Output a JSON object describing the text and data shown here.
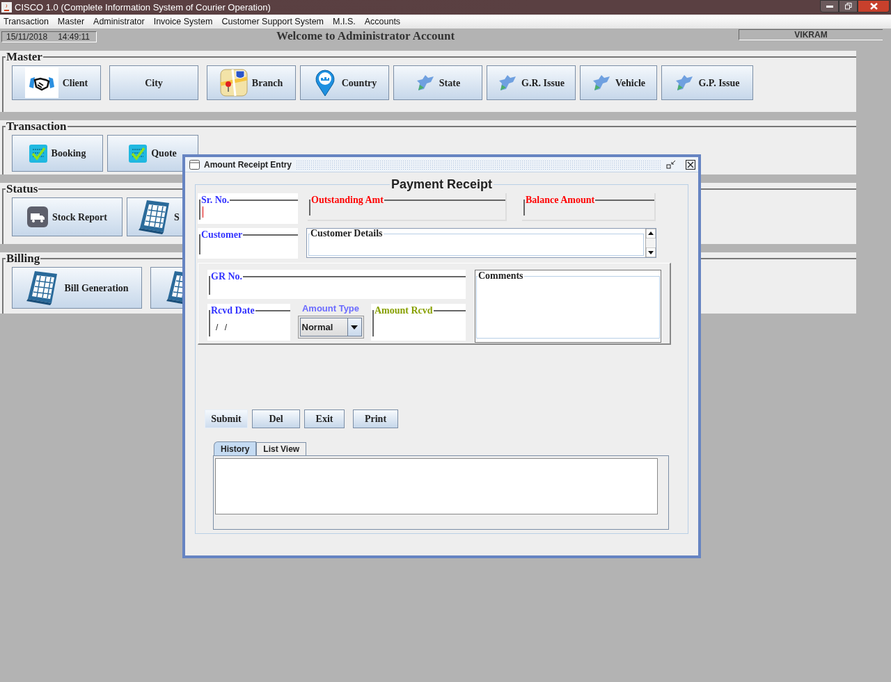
{
  "window": {
    "title": "CISCO 1.0 (Complete Information System of Courier Operation)"
  },
  "menu": [
    "Transaction",
    "Master",
    "Administrator",
    "Invoice System",
    "Customer Support System",
    "M.I.S.",
    "Accounts"
  ],
  "info_bar": {
    "date": "15/11/2018",
    "time": "14:49:11",
    "welcome": "Welcome to Administrator Account",
    "user": "VIKRAM"
  },
  "sections": [
    {
      "title": "Master",
      "buttons": [
        "Client",
        "City",
        "Branch",
        "Country",
        "State",
        "G.R. Issue",
        "Vehicle",
        "G.P. Issue"
      ]
    },
    {
      "title": "Transaction",
      "buttons": [
        "Booking",
        "Quote"
      ]
    },
    {
      "title": "Status",
      "buttons": [
        "Stock Report",
        "S"
      ]
    },
    {
      "title": "Billing",
      "buttons": [
        "Bill Generation"
      ]
    }
  ],
  "dialog": {
    "title": "Amount Receipt Entry",
    "heading": "Payment Receipt",
    "sr_no": {
      "label": "Sr. No.",
      "color": "#3333ff",
      "focused": true
    },
    "outstanding": {
      "label": "Outstanding Amt",
      "color": "#ff0000"
    },
    "balance": {
      "label": "Balance Amount",
      "color": "#ff0000"
    },
    "customer": {
      "label": "Customer",
      "color": "#3333ff"
    },
    "customer_details": {
      "label": "Customer Details",
      "color": "#222222"
    },
    "gr_no": {
      "label": "GR No.",
      "color": "#3333ff"
    },
    "rcvd_date": {
      "label": "Rcvd Date",
      "color": "#3333ff",
      "value": "/ /"
    },
    "amount_type": {
      "label": "Amount Type",
      "value": "Normal"
    },
    "amount_rcvd": {
      "label": "Amount Rcvd",
      "color": "#88a000"
    },
    "comments": {
      "label": "Comments",
      "color": "#222222"
    },
    "buttons": [
      {
        "label": "Submit",
        "focused": true
      },
      {
        "label": "Del",
        "focused": false
      },
      {
        "label": "Exit",
        "focused": false
      },
      {
        "label": "Print",
        "focused": false
      }
    ],
    "tabs": [
      {
        "label": "History",
        "selected": true
      },
      {
        "label": "List View",
        "selected": false
      }
    ]
  }
}
